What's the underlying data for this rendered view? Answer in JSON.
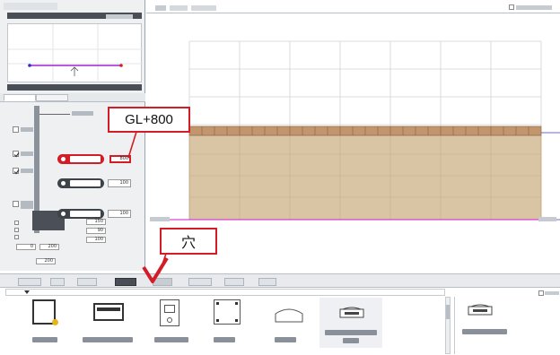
{
  "callouts": {
    "gl_offset": "GL+800",
    "hole": "穴"
  },
  "colors": {
    "accent": "#d41c26",
    "wall_fill": "#d9c5a4",
    "wall_border": "#b7a07d",
    "cap": "#c2956d",
    "ground_line": "#d21ad2"
  },
  "side_values": {
    "upper_field": "800",
    "mid_field": "100",
    "lower_field": "100",
    "stack": [
      "150",
      "90",
      "100"
    ],
    "bottom_a": "0",
    "bottom_b": "200",
    "bottom_c": "200"
  },
  "icons": {
    "check": "check-mark",
    "arrow": "pointer-arrow"
  }
}
